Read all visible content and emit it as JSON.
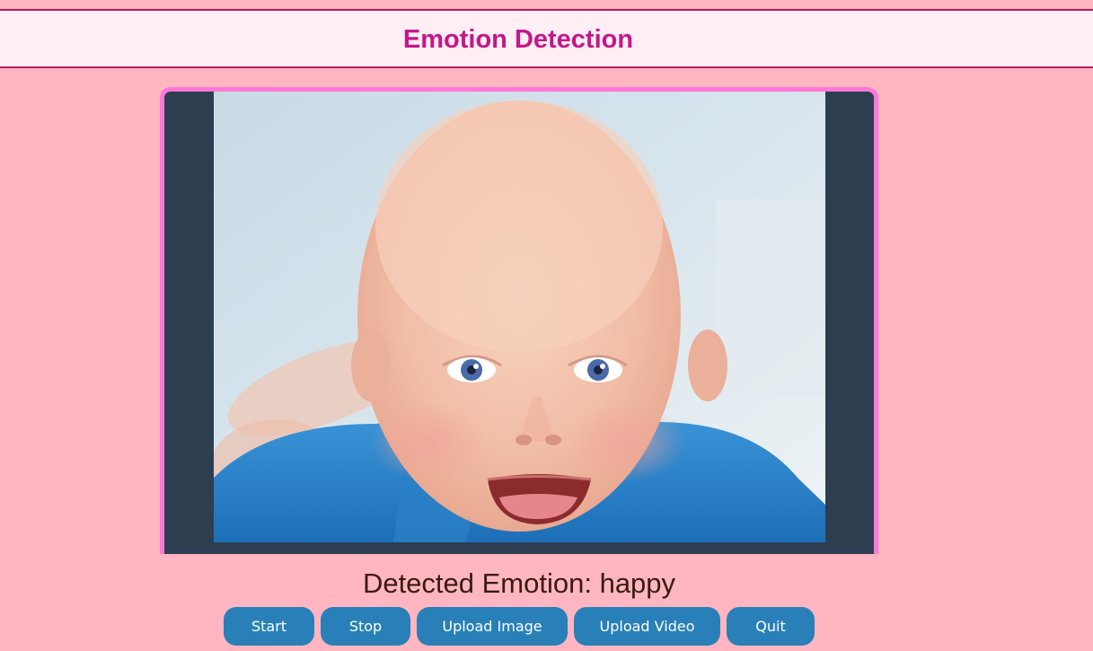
{
  "header": {
    "title": "Emotion Detection"
  },
  "video": {
    "subject": "baby-photo"
  },
  "result": {
    "label": "Detected Emotion: happy"
  },
  "controls": {
    "start_label": "Start",
    "stop_label": "Stop",
    "upload_image_label": "Upload Image",
    "upload_video_label": "Upload Video",
    "quit_label": "Quit"
  },
  "colors": {
    "background": "#ffb6c1",
    "header_background": "#ffeef3",
    "header_border": "#c2185b",
    "title": "#c2188b",
    "frame_border": "#ff77d9",
    "frame_background": "#2c3e50",
    "button": "#2980b9",
    "button_text": "#ffffff",
    "result_text": "#3a1a10"
  }
}
